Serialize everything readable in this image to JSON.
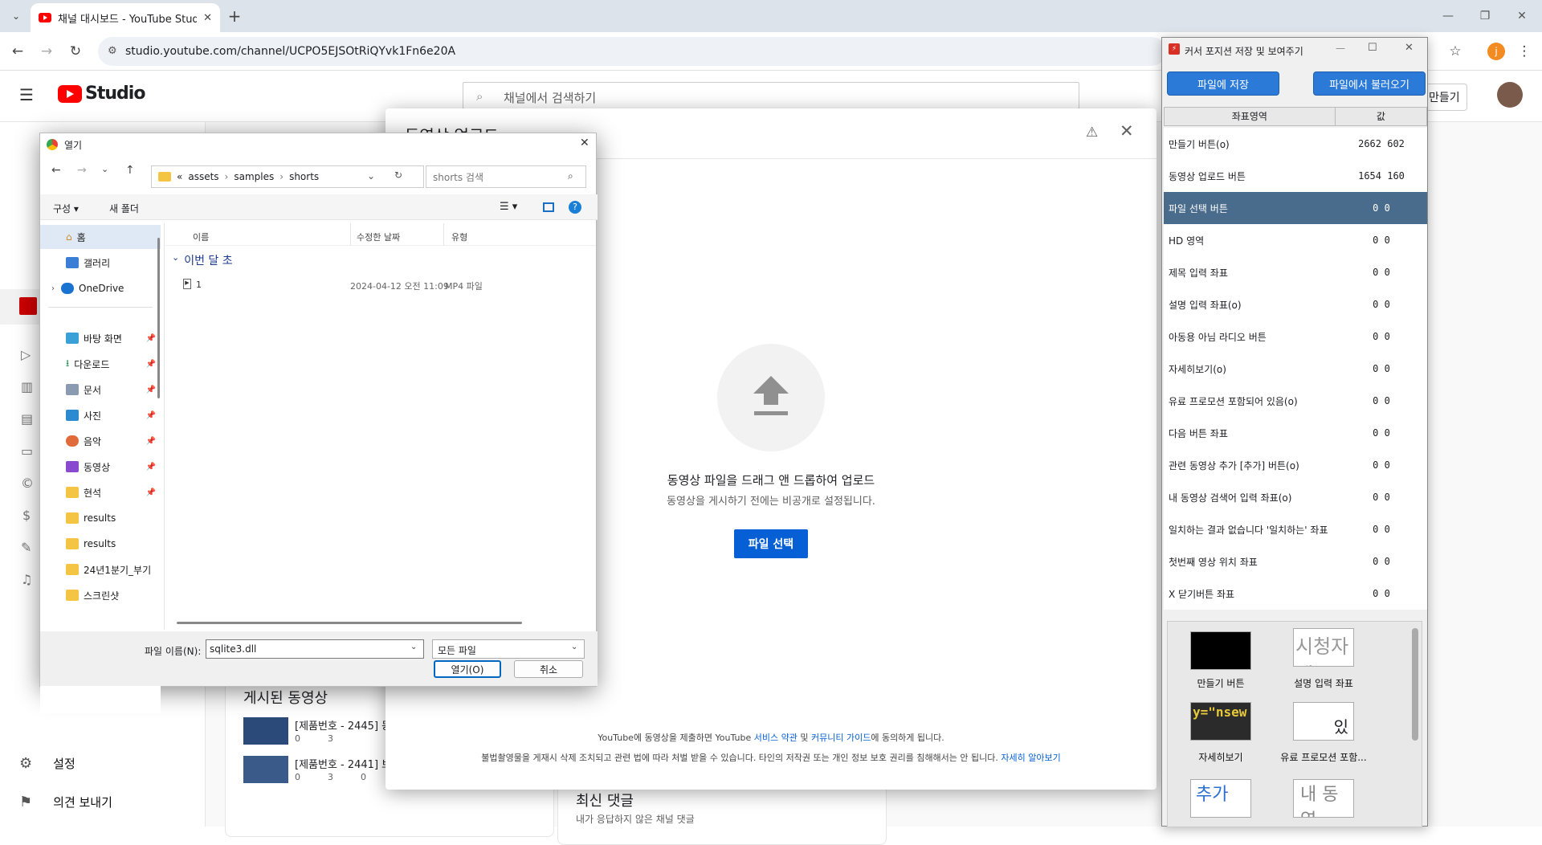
{
  "browser": {
    "tab_title": "채널 대시보드 - YouTube Studi",
    "url": "studio.youtube.com/channel/UCPO5EJSOtRiQYvk1Fn6e20A",
    "profile_initial": "j"
  },
  "studio": {
    "logo_text": "Studio",
    "search_placeholder": "채널에서 검색하기",
    "create_label": "만들기",
    "side_items": {
      "settings": "설정",
      "feedback": "의견 보내기"
    },
    "published_title": "게시된 동영상",
    "videos": [
      {
        "title": "[제품번호 - 2445] 동",
        "views": "0",
        "comments": "3"
      },
      {
        "title": "[제품번호 - 2441] 브",
        "views": "0",
        "comments": "3",
        "likes": "0"
      }
    ],
    "latest_comments_title": "최신 댓글",
    "latest_comments_sub": "내가 응답하지 않은 채널 댓글"
  },
  "upload_modal": {
    "title": "동영상 업로드",
    "drag_text": "동영상 파일을 드래그 앤 드롭하여 업로드",
    "private_note": "동영상을 게시하기 전에는 비공개로 설정됩니다.",
    "select_button": "파일 선택",
    "terms_prefix": "YouTube에 동영상을 제출하면 YouTube",
    "terms_link1": "서비스 약관",
    "terms_and": "및",
    "terms_link2": "커뮤니티 가이드",
    "terms_suffix": "에 동의하게 됩니다.",
    "copyright_text": "불법촬영물을 게재시 삭제 조치되고 관련 법에 따라 처벌 받을 수 있습니다. 타인의 저작권 또는 개인 정보 보호 권리를 침해해서는 안 됩니다.",
    "learn_more": "자세히 알아보기"
  },
  "file_dialog": {
    "title": "열기",
    "path_prefix": "«",
    "path": [
      "assets",
      "samples",
      "shorts"
    ],
    "search_placeholder": "shorts 검색",
    "organize": "구성",
    "new_folder": "새 폴더",
    "columns": {
      "name": "이름",
      "date": "수정한 날짜",
      "type": "유형"
    },
    "group_label": "이번 달 초",
    "files": [
      {
        "name": "1",
        "date": "2024-04-12 오전 11:09",
        "type": "MP4 파일"
      }
    ],
    "nav": {
      "home": "홈",
      "gallery": "갤러리",
      "onedrive": "OneDrive",
      "desktop": "바탕 화면",
      "downloads": "다운로드",
      "documents": "문서",
      "pictures": "사진",
      "music": "음악",
      "videos": "동영상",
      "folder1": "현석",
      "folder2": "results",
      "folder3": "results",
      "folder4": "24년1분기_부기",
      "folder5": "스크린샷"
    },
    "filename_label": "파일 이름(N):",
    "filename_value": "sqlite3.dll",
    "filter": "모든 파일",
    "open_button": "열기(O)",
    "cancel_button": "취소"
  },
  "cursor_tool": {
    "title": "커서 포지션 저장 및 보여주기",
    "save_button": "파일에 저장",
    "load_button": "파일에서 불러오기",
    "col_name": "좌표영역",
    "col_value": "값",
    "rows": [
      {
        "name": "만들기 버튼(o)",
        "value": "2662 602"
      },
      {
        "name": "동영상 업로드 버튼",
        "value": "1654 160"
      },
      {
        "name": "파일 선택 버튼",
        "value": "0 0"
      },
      {
        "name": "HD 영역",
        "value": "0 0"
      },
      {
        "name": "제목 입력 좌표",
        "value": "0 0"
      },
      {
        "name": "설명 입력 좌표(o)",
        "value": "0 0"
      },
      {
        "name": "아동용 아님 라디오 버튼",
        "value": "0 0"
      },
      {
        "name": "자세히보기(o)",
        "value": "0 0"
      },
      {
        "name": "유료 프로모션 포함되어 있음(o)",
        "value": "0 0"
      },
      {
        "name": "다음 버튼 좌표",
        "value": "0 0"
      },
      {
        "name": "관련 동영상 추가 [추가] 버튼(o)",
        "value": "0 0"
      },
      {
        "name": "내 동영상 검색어 입력 좌표(o)",
        "value": "0 0"
      },
      {
        "name": "일치하는 결과 없습니다 '일치하는' 좌표",
        "value": "0 0"
      },
      {
        "name": "첫번째 영상 위치 좌표",
        "value": "0 0"
      },
      {
        "name": "X 닫기버튼 좌표",
        "value": "0 0"
      }
    ],
    "thumbnails": [
      {
        "label": "만들기 버튼",
        "preview": ""
      },
      {
        "label": "설명 입력 좌표",
        "preview": "시청자에"
      },
      {
        "label": "자세히보기",
        "preview": "y=\"nsew"
      },
      {
        "label": "유료 프로모션 포함...",
        "preview": "있"
      },
      {
        "label": "",
        "preview": "추가"
      },
      {
        "label": "",
        "preview": "내 동영"
      }
    ]
  },
  "colors": {
    "youtube_red": "#ff0000",
    "studio_blue": "#065fd4",
    "selected_row": "#4a6c8c",
    "tool_button": "#2b7ad8"
  }
}
